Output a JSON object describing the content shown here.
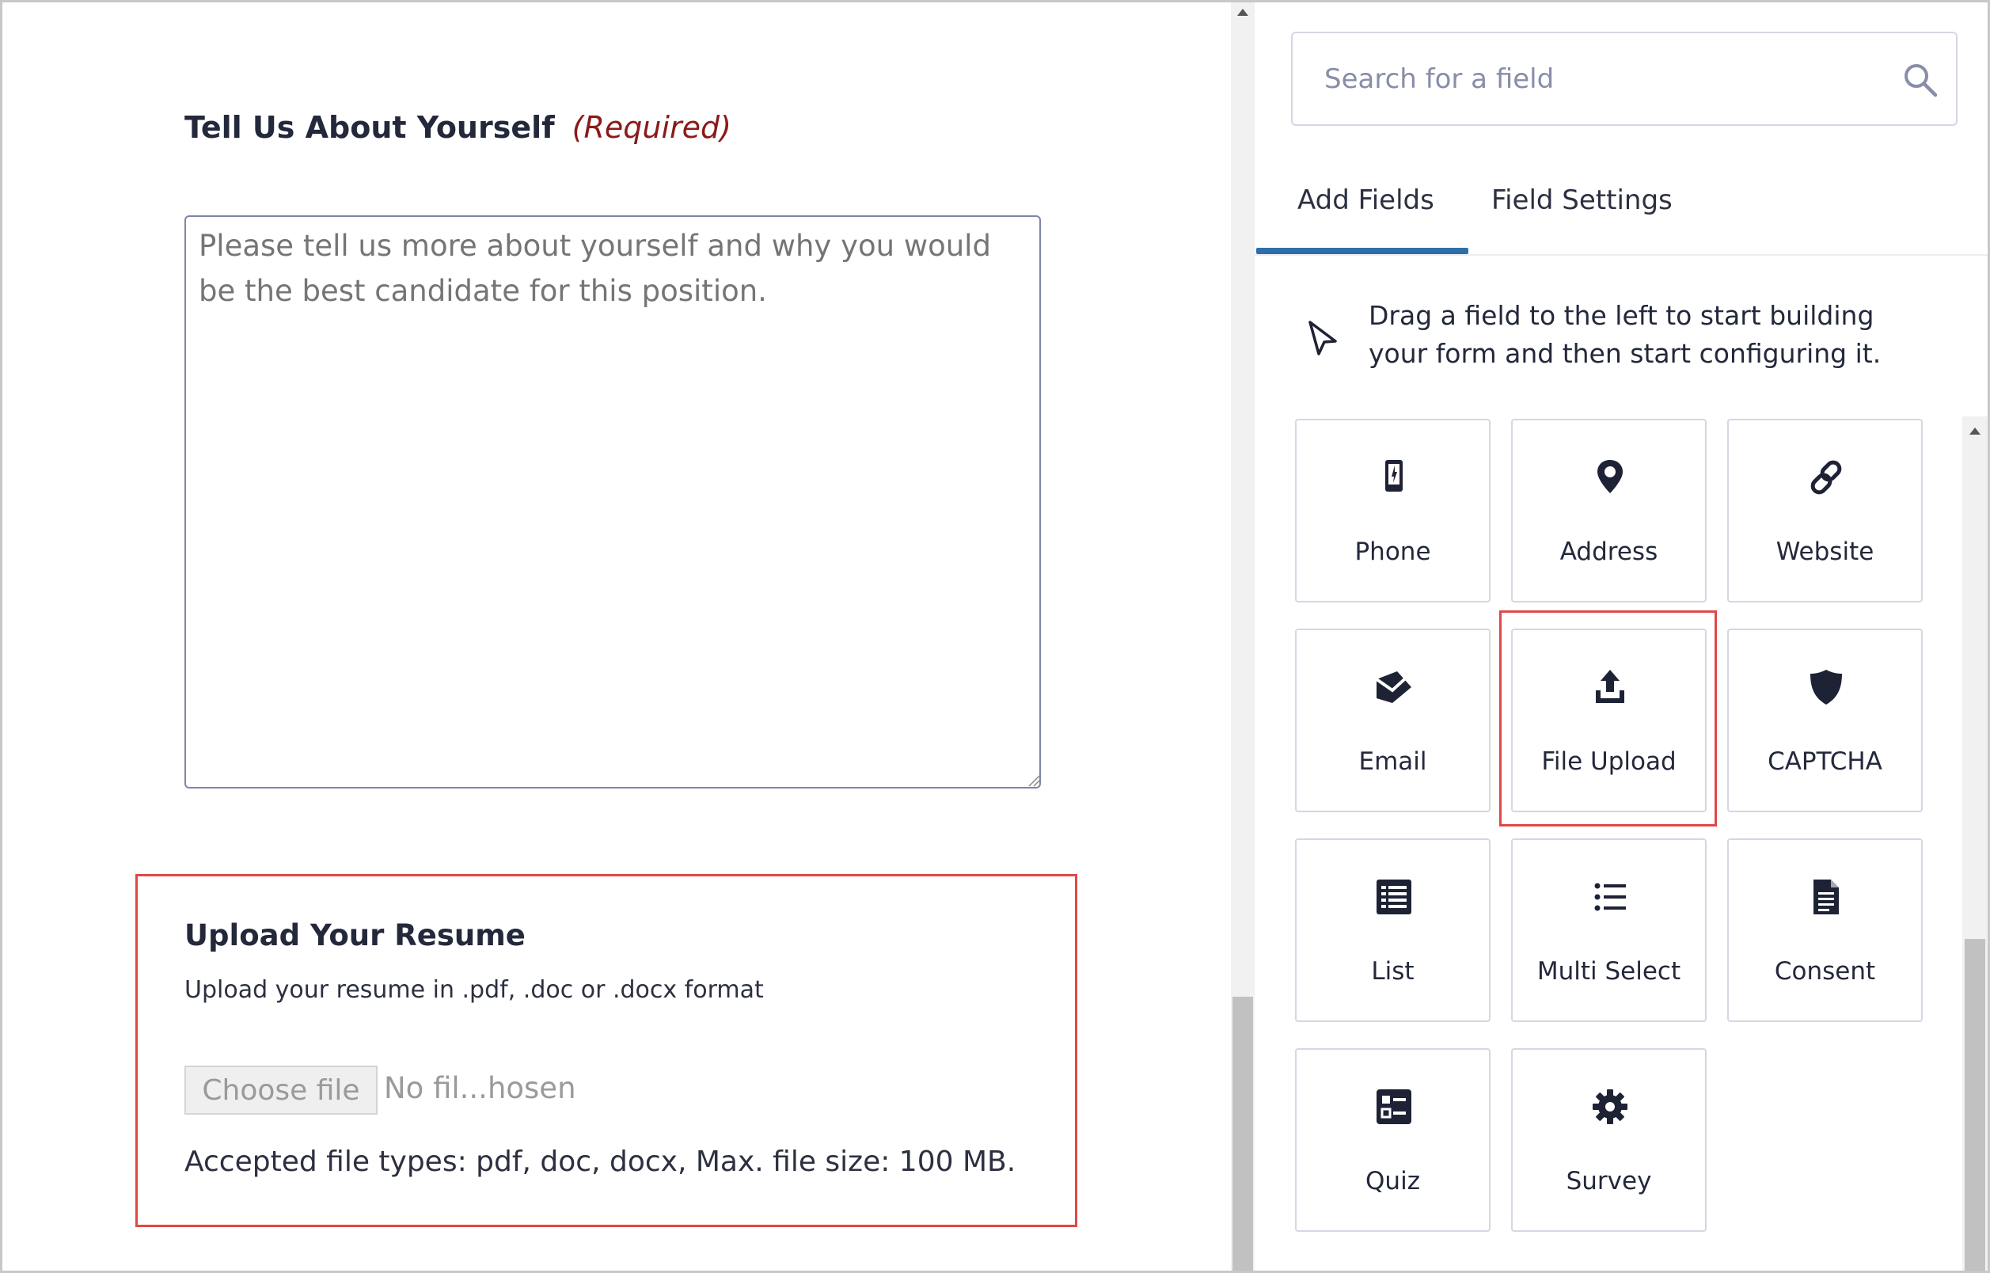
{
  "form": {
    "about_label": "Tell Us About Yourself",
    "about_required": "(Required)",
    "about_placeholder": "Please tell us more about yourself and why you would be the best candidate for this position.",
    "upload_title": "Upload Your Resume",
    "upload_description": "Upload your resume in .pdf, .doc or .docx format",
    "choose_file_label": "Choose file",
    "no_file_text": "No fil...hosen",
    "accepted_text": "Accepted file types: pdf, doc, docx, Max. file size: 100 MB."
  },
  "sidebar": {
    "search_placeholder": "Search for a field",
    "tabs": [
      {
        "label": "Add Fields",
        "active": true
      },
      {
        "label": "Field Settings",
        "active": false
      }
    ],
    "hint": "Drag a field to the left to start building your form and then start configuring it.",
    "fields": [
      {
        "label": "Phone",
        "icon": "phone-icon"
      },
      {
        "label": "Address",
        "icon": "map-pin-icon"
      },
      {
        "label": "Website",
        "icon": "link-icon"
      },
      {
        "label": "Email",
        "icon": "envelope-icon"
      },
      {
        "label": "File Upload",
        "icon": "upload-icon",
        "highlighted": true
      },
      {
        "label": "CAPTCHA",
        "icon": "shield-icon"
      },
      {
        "label": "List",
        "icon": "list-icon"
      },
      {
        "label": "Multi Select",
        "icon": "bulleted-list-icon"
      },
      {
        "label": "Consent",
        "icon": "document-icon"
      },
      {
        "label": "Quiz",
        "icon": "quiz-icon"
      },
      {
        "label": "Survey",
        "icon": "gear-icon"
      }
    ],
    "colors": {
      "accent": "#2f6ea7",
      "required": "#8b1a1a",
      "highlight": "#e04848",
      "icon": "#1e2235"
    }
  }
}
